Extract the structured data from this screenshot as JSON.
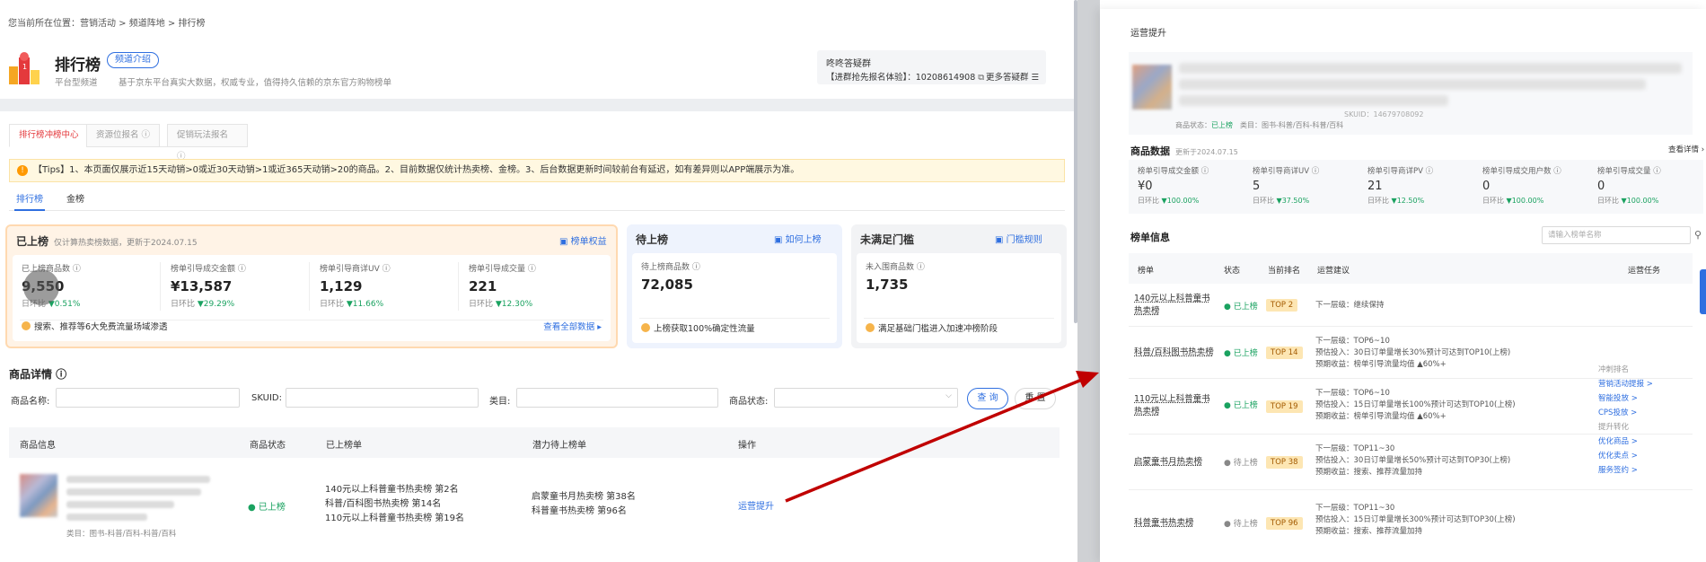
{
  "breadcrumb": "您当前所在位置：营销活动 > 频道阵地 > 排行榜",
  "header": {
    "title": "排行榜",
    "intro_chip": "频道介绍",
    "channel_type": "平台型频道",
    "description": "基于京东平台真实大数据，权威专业，值得持久信赖的京东官方购物榜单",
    "group_title": "咚咚答疑群",
    "group_text": "【进群抢先报名体验】：10208614908",
    "group_more": "更多答疑群"
  },
  "top_tabs": [
    "排行榜冲榜中心",
    "资源位报名 ⓘ",
    "促销玩法报名 ⓘ"
  ],
  "tips": "【Tips】1、本页面仅展示近15天动销>0或近30天动销>1或近365天动销>20的商品。2、目前数据仅统计热卖榜、金榜。3、后台数据更新时间较前台有延迟，如有差异则以APP端展示为准。",
  "sub_tabs": [
    "排行榜",
    "金榜"
  ],
  "cards": {
    "listed": {
      "title": "已上榜",
      "note": "仅计算热卖榜数据，更新于2024.07.15",
      "link": "榜单权益",
      "metrics": [
        {
          "label": "已上榜商品数 ⓘ",
          "value": "9,550",
          "change_label": "日环比",
          "change": "▼0.51%"
        },
        {
          "label": "榜单引导成交金额 ⓘ",
          "value": "¥13,587",
          "change_label": "日环比",
          "change": "▼29.29%"
        },
        {
          "label": "榜单引导商详UV ⓘ",
          "value": "1,129",
          "change_label": "日环比",
          "change": "▼11.66%"
        },
        {
          "label": "榜单引导成交量 ⓘ",
          "value": "221",
          "change_label": "日环比",
          "change": "▼12.30%"
        }
      ],
      "footer": "搜索、推荐等6大免费流量场域渗透",
      "footer_link": "查看全部数据 ▸"
    },
    "pending": {
      "title": "待上榜",
      "link": "如何上榜",
      "metric_label": "待上榜商品数 ⓘ",
      "metric_value": "72,085",
      "footer": "上榜获取100%确定性流量"
    },
    "unmet": {
      "title": "未满足门槛",
      "link": "门槛规则",
      "metric_label": "未入围商品数 ⓘ",
      "metric_value": "1,735",
      "footer": "满足基础门槛进入加速冲榜阶段"
    }
  },
  "product_details": {
    "title": "商品详情 ⓘ",
    "filters": {
      "name": "商品名称:",
      "skuid": "SKUID:",
      "category": "类目:",
      "status": "商品状态:"
    },
    "query_button": "查 询",
    "reset_button": "重 置",
    "columns": [
      "商品信息",
      "商品状态",
      "已上榜单",
      "潜力待上榜单",
      "操作"
    ],
    "row": {
      "category": "类目：图书-科普/百科-科普/百科",
      "status": "● 已上榜",
      "listed": [
        "140元以上科普童书热卖榜 第2名",
        "科普/百科图书热卖榜 第14名",
        "110元以上科普童书热卖榜 第19名"
      ],
      "potential": [
        "启蒙童书月热卖榜 第38名",
        "科普童书热卖榜 第96名"
      ],
      "action": "运营提升"
    }
  },
  "panel": {
    "title": "运营提升",
    "product_status_label": "商品状态：",
    "product_status": "已上榜",
    "product_category": "类目：图书-科普/百科-科普/百科",
    "skuid": "SKUID：14679708092",
    "data_title": "商品数据",
    "data_updated": "更新于2024.07.15",
    "data_more": "查看详情 ›",
    "metrics": [
      {
        "label": "榜单引导成交金额 ⓘ",
        "value": "¥0",
        "change_label": "日环比",
        "change": "▼100.00%"
      },
      {
        "label": "榜单引导商详UV ⓘ",
        "value": "5",
        "change_label": "日环比",
        "change": "▼37.50%"
      },
      {
        "label": "榜单引导商详PV ⓘ",
        "value": "21",
        "change_label": "日环比",
        "change": "▼12.50%"
      },
      {
        "label": "榜单引导成交用户数 ⓘ",
        "value": "0",
        "change_label": "日环比",
        "change": "▼100.00%"
      },
      {
        "label": "榜单引导成交量 ⓘ",
        "value": "0",
        "change_label": "日环比",
        "change": "▼100.00%"
      }
    ],
    "list_title": "榜单信息",
    "search_placeholder": "请输入榜单名称",
    "columns": [
      "榜单",
      "状态",
      "当前排名",
      "运营建议",
      "运营任务"
    ],
    "rows": [
      {
        "name": "140元以上科普童书热卖榜",
        "status": "● 已上榜",
        "rank": "TOP 2",
        "advice": [
          "下一层级：继续保持"
        ]
      },
      {
        "name": "科普/百科图书热卖榜",
        "status": "● 已上榜",
        "rank": "TOP 14",
        "advice": [
          "下一层级：TOP6~10",
          "预估投入：30日订单量增长30%预计可达到TOP10(上榜)",
          "预期收益：榜单引导流量均值 ▲60%+"
        ]
      },
      {
        "name": "110元以上科普童书热卖榜",
        "status": "● 已上榜",
        "rank": "TOP 19",
        "advice": [
          "下一层级：TOP6~10",
          "预估投入：15日订单量增长100%预计可达到TOP10(上榜)",
          "预期收益：榜单引导流量均值 ▲60%+"
        ]
      },
      {
        "name": "启蒙童书月热卖榜",
        "status": "● 待上榜",
        "rank": "TOP 38",
        "advice": [
          "下一层级：TOP11~30",
          "预估投入：30日订单量增长50%预计可达到TOP30(上榜)",
          "预期收益：搜索、推荐流量加持"
        ]
      },
      {
        "name": "科普童书热卖榜",
        "status": "● 待上榜",
        "rank": "TOP 96",
        "advice": [
          "下一层级：TOP11~30",
          "预估投入：15日订单量增长300%预计可达到TOP30(上榜)",
          "预期收益：搜索、推荐流量加持"
        ]
      }
    ],
    "tasks_header_1": "冲刺排名",
    "tasks_1": [
      "营销活动提报 >",
      "智能投放 >",
      "CPS投放 >"
    ],
    "tasks_header_2": "提升转化",
    "tasks_2": [
      "优化商品 >",
      "优化卖点 >",
      "服务签约 >"
    ]
  },
  "colors": {
    "accent": "#2f6fe0",
    "up_down": "#1aa260",
    "arrow": "#c00000",
    "warning": "#ff9900"
  }
}
